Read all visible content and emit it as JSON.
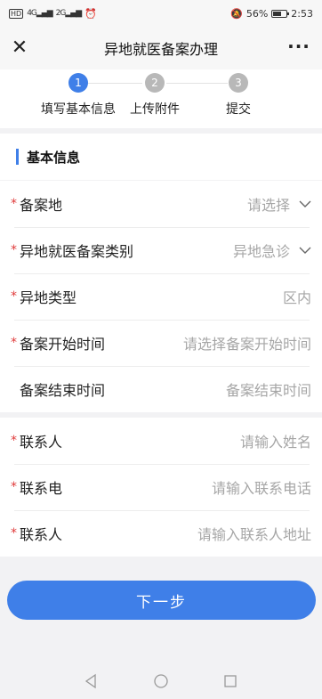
{
  "status_bar": {
    "left_text": "HD",
    "signal_1": "4G",
    "signal_2": "2G",
    "battery_percent": "56%",
    "time": "2:53"
  },
  "header": {
    "close_icon": "close-icon",
    "title": "异地就医备案办理",
    "more_icon": "more-icon"
  },
  "steps": [
    {
      "number": "1",
      "label": "填写基本信息",
      "active": true
    },
    {
      "number": "2",
      "label": "上传附件",
      "active": false
    },
    {
      "number": "3",
      "label": "提交",
      "active": false
    }
  ],
  "section": {
    "title": "基本信息"
  },
  "form_group_1": [
    {
      "required": "*",
      "label": "备案地",
      "value": "请选择",
      "has_chevron": true
    },
    {
      "required": "*",
      "label": "异地就医备案类别",
      "value": "异地急诊",
      "has_chevron": true
    },
    {
      "required": "*",
      "label": "异地类型",
      "value": "区内",
      "has_chevron": false
    },
    {
      "required": "*",
      "label": "备案开始时间",
      "value": "请选择备案开始时间",
      "has_chevron": false
    },
    {
      "required": "",
      "label": "备案结束时间",
      "value": "备案结束时间",
      "has_chevron": false
    }
  ],
  "form_group_2": [
    {
      "required": "*",
      "label": "联系人",
      "value": "请输入姓名"
    },
    {
      "required": "*",
      "label": "联系电",
      "value": "请输入联系电话"
    },
    {
      "required": "*",
      "label": "联系人",
      "value": "请输入联系人地址"
    }
  ],
  "actions": {
    "next_label": "下一步"
  },
  "colors": {
    "accent": "#3f7fe8",
    "required": "#e03a3a",
    "step_inactive": "#b8b8b8",
    "placeholder": "#a6a6a6"
  },
  "nav_icons": [
    "back-icon",
    "home-icon",
    "recents-icon"
  ]
}
